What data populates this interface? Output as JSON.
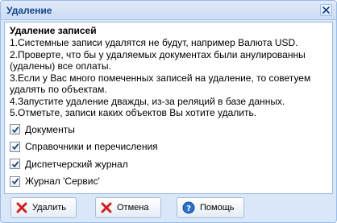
{
  "dialog": {
    "title": "Удаление",
    "heading": "Удаление записей",
    "lines": [
      "1.Системные записи удалятся не будут, например Валюта USD.",
      "2.Проверте, что бы у удаляемых документах были анулированны",
      "(удалены) все оплаты.",
      "3.Если у Вас много помеченных записей на удаление, то советуем",
      "удалять по объектам.",
      "4.Запустите удаление дважды, из-за реляций в базе данных.",
      "5.Отметьте, записи каких объектов Вы хотите удалить."
    ],
    "options": [
      {
        "label": "Документы",
        "checked": true
      },
      {
        "label": "Справочники и перечисления",
        "checked": true
      },
      {
        "label": "Диспетчерский журнал",
        "checked": true
      },
      {
        "label": "Журнал 'Сервис'",
        "checked": true
      }
    ]
  },
  "buttons": {
    "delete_label": "Удалить",
    "cancel_label": "Отмена",
    "help_label": "Помощь"
  },
  "icons": {
    "close": "close-icon",
    "delete": "red-x-icon",
    "cancel": "red-x-icon",
    "help": "help-icon"
  },
  "colors": {
    "title_text": "#15428b",
    "window_bg": "#d9e7f8",
    "border": "#99bbe8",
    "red_x": "#d42020",
    "help_blue": "#2a6fc9"
  }
}
